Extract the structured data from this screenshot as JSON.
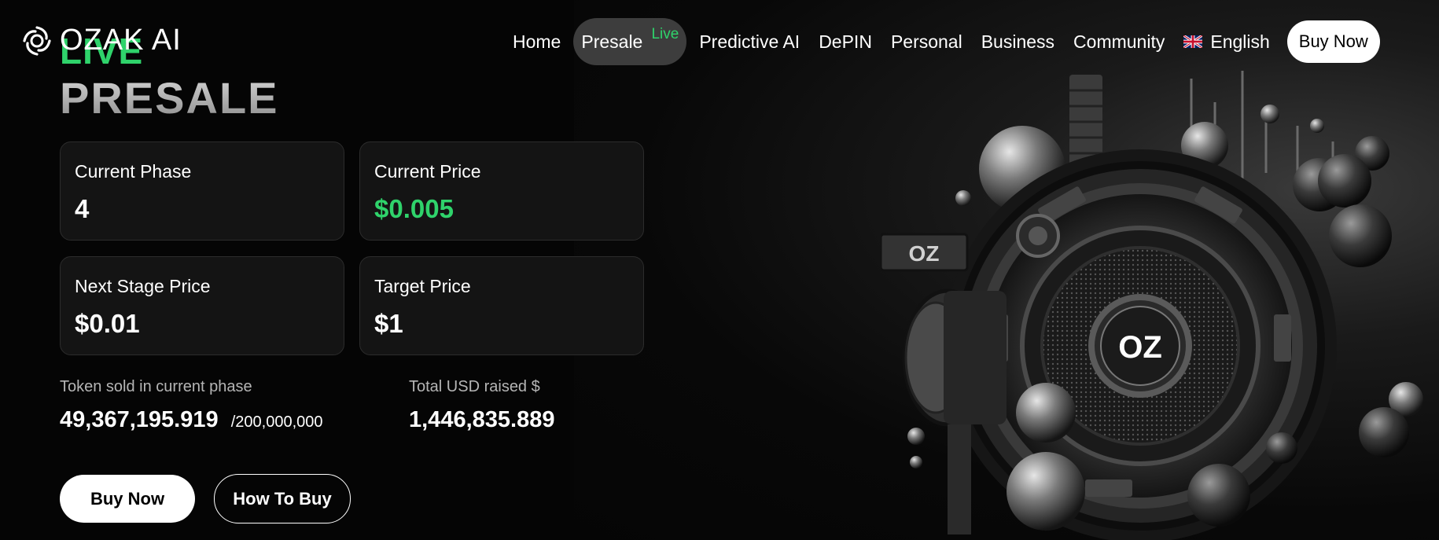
{
  "brand": {
    "name": "OZAK AI"
  },
  "nav": {
    "items": [
      "Home",
      "Presale",
      "Predictive AI",
      "DePIN",
      "Personal",
      "Business",
      "Community"
    ],
    "presale_badge": "Live",
    "language": "English",
    "buy_label": "Buy Now"
  },
  "hero": {
    "live": "LIVE",
    "title": "PRESALE"
  },
  "cards": [
    {
      "label": "Current Phase",
      "value": "4"
    },
    {
      "label": "Current Price",
      "value": "$0.005"
    },
    {
      "label": "Next Stage Price",
      "value": "$0.01"
    },
    {
      "label": "Target Price",
      "value": "$1"
    }
  ],
  "stats": {
    "tokens_label": "Token sold in current phase",
    "tokens_sold": "49,367,195.919",
    "tokens_total": "/200,000,000",
    "usd_label": "Total USD raised $",
    "usd_raised": "1,446,835.889"
  },
  "buttons": {
    "buy": "Buy Now",
    "how": "How To Buy"
  },
  "art": {
    "badge_small": "OZ",
    "badge_center": "OZ"
  },
  "colors": {
    "accent": "#2fd36b",
    "background": "#050505",
    "card": "#141414"
  }
}
